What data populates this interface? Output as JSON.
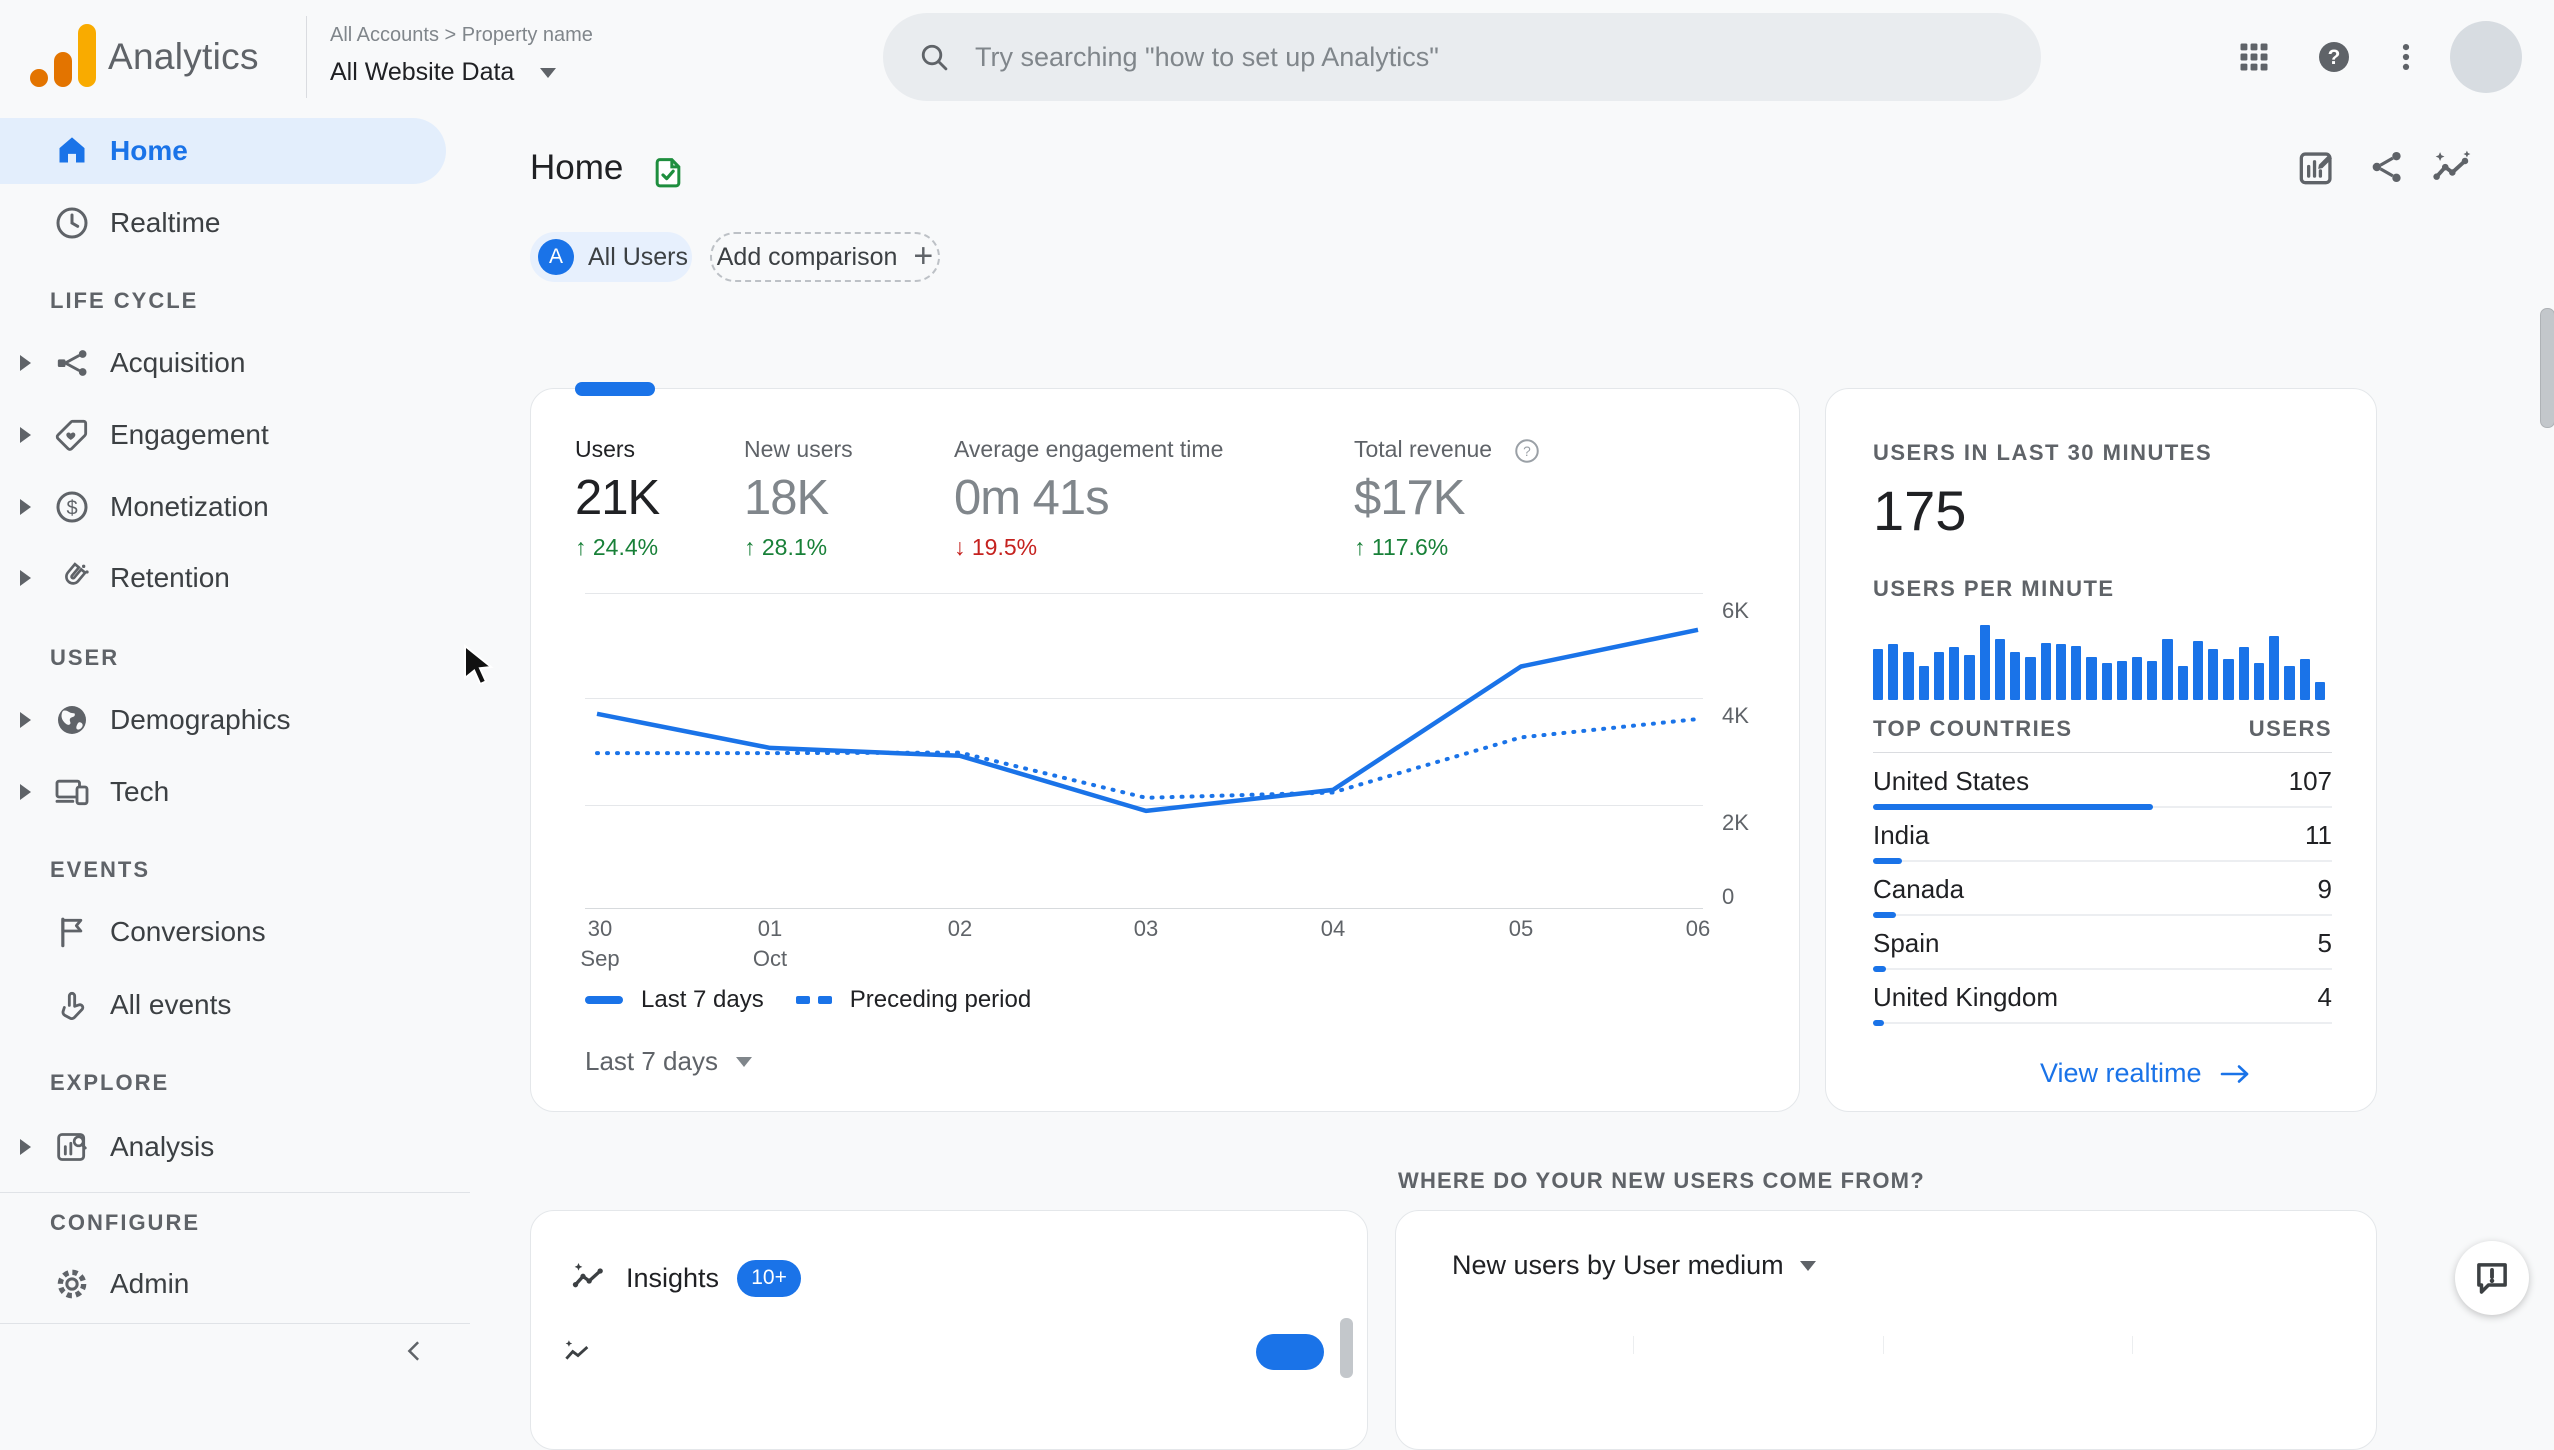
{
  "header": {
    "product": "Analytics",
    "breadcrumb": "All Accounts  >  Property name",
    "property": "All Website Data",
    "search_placeholder": "Try searching \"how to set up Analytics\""
  },
  "sidebar": {
    "entries": [
      {
        "type": "item",
        "label": "Home",
        "icon": "home",
        "active": true
      },
      {
        "type": "item",
        "label": "Realtime",
        "icon": "clock"
      },
      {
        "type": "header",
        "label": "LIFE CYCLE"
      },
      {
        "type": "item",
        "label": "Acquisition",
        "icon": "acquisition",
        "expandable": true
      },
      {
        "type": "item",
        "label": "Engagement",
        "icon": "engagement",
        "expandable": true
      },
      {
        "type": "item",
        "label": "Monetization",
        "icon": "monetization",
        "expandable": true
      },
      {
        "type": "item",
        "label": "Retention",
        "icon": "retention",
        "expandable": true
      },
      {
        "type": "header",
        "label": "USER"
      },
      {
        "type": "item",
        "label": "Demographics",
        "icon": "demographics",
        "expandable": true
      },
      {
        "type": "item",
        "label": "Tech",
        "icon": "tech",
        "expandable": true
      },
      {
        "type": "header",
        "label": "EVENTS"
      },
      {
        "type": "item",
        "label": "Conversions",
        "icon": "flag"
      },
      {
        "type": "item",
        "label": "All events",
        "icon": "touch"
      },
      {
        "type": "header",
        "label": "EXPLORE"
      },
      {
        "type": "item",
        "label": "Analysis",
        "icon": "analysis",
        "expandable": true
      },
      {
        "type": "header",
        "label": "CONFIGURE"
      },
      {
        "type": "item",
        "label": "Admin",
        "icon": "gear"
      }
    ]
  },
  "main": {
    "title": "Home",
    "comparison": {
      "initial": "A",
      "primary": "All Users",
      "add_label": "Add comparison"
    },
    "overview": {
      "metrics": [
        {
          "label": "Users",
          "value": "21K",
          "delta": "24.4%",
          "arrow": "↑",
          "direction": "up"
        },
        {
          "label": "New users",
          "value": "18K",
          "delta": "28.1%",
          "arrow": "↑",
          "direction": "up"
        },
        {
          "label": "Average engagement time",
          "value": "0m 41s",
          "delta": "19.5%",
          "arrow": "↓",
          "direction": "down"
        },
        {
          "label": "Total revenue",
          "value": "$17K",
          "delta": "117.6%",
          "arrow": "↑",
          "direction": "up",
          "help": "?"
        }
      ],
      "yticks": [
        "6K",
        "4K",
        "2K",
        "0"
      ],
      "xticks": [
        {
          "t": "30",
          "s": "Sep"
        },
        {
          "t": "01",
          "s": "Oct"
        },
        {
          "t": "02"
        },
        {
          "t": "03"
        },
        {
          "t": "04"
        },
        {
          "t": "05"
        },
        {
          "t": "06"
        }
      ],
      "legend": {
        "solid": "Last 7 days",
        "dashed": "Preceding period"
      },
      "range_label": "Last 7 days"
    }
  },
  "realtime": {
    "title": "USERS IN LAST 30 MINUTES",
    "value": "175",
    "per_minute_label": "USERS PER MINUTE",
    "countries": {
      "col_country": "TOP COUNTRIES",
      "col_users": "USERS",
      "total": 175,
      "rows": [
        {
          "name": "United States",
          "users": 107
        },
        {
          "name": "India",
          "users": 11
        },
        {
          "name": "Canada",
          "users": 9
        },
        {
          "name": "Spain",
          "users": 5
        },
        {
          "name": "United Kingdom",
          "users": 4
        }
      ]
    },
    "link": "View realtime"
  },
  "insights": {
    "title": "Insights",
    "badge": "10+"
  },
  "new_users": {
    "section_title": "WHERE DO YOUR NEW USERS COME FROM?",
    "card_title": "New users by User medium"
  },
  "chart_data": [
    {
      "type": "line",
      "title": "Users (last 7 days vs preceding period)",
      "x": [
        "30 Sep",
        "01 Oct",
        "02",
        "03",
        "04",
        "05",
        "06"
      ],
      "ylim": [
        0,
        6000
      ],
      "yticks": [
        0,
        2000,
        4000,
        6000
      ],
      "grid": true,
      "legend_position": "bottom",
      "series": [
        {
          "name": "Last 7 days",
          "style": "solid",
          "values": [
            3700,
            3050,
            2900,
            1850,
            2250,
            4600,
            5300
          ]
        },
        {
          "name": "Preceding period",
          "style": "dashed",
          "values": [
            2950,
            2950,
            2960,
            2100,
            2200,
            3250,
            3600
          ]
        }
      ]
    },
    {
      "type": "bar",
      "title": "Users per minute (last 30 minutes)",
      "values": [
        62,
        68,
        58,
        42,
        58,
        65,
        55,
        92,
        75,
        58,
        52,
        70,
        68,
        66,
        52,
        45,
        48,
        52,
        48,
        75,
        42,
        72,
        62,
        50,
        65,
        45,
        78,
        42,
        50,
        22
      ]
    },
    {
      "type": "table",
      "title": "Top countries by users (last 30 minutes)",
      "categories": [
        "United States",
        "India",
        "Canada",
        "Spain",
        "United Kingdom"
      ],
      "values": [
        107,
        11,
        9,
        5,
        4
      ]
    }
  ]
}
